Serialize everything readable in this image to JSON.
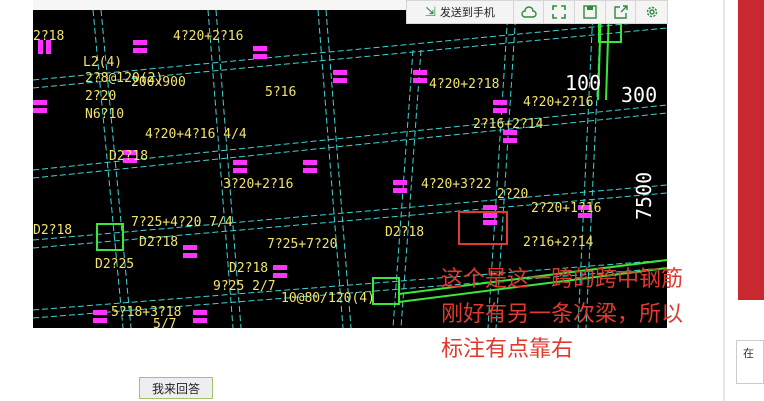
{
  "toolbar": {
    "send_to_phone_label": "发送到手机",
    "icons": [
      "cloud-icon",
      "fullscreen-icon",
      "save-icon",
      "share-icon",
      "settings-icon"
    ]
  },
  "drawing": {
    "labels": {
      "l1": "L2(4)",
      "l2": "200x900",
      "l3": "2?8@120(2)",
      "l4": "2?20",
      "l5": "N6?10",
      "l6": "4?20+2?16",
      "l7": "5?16",
      "l8": "4?20+4?16  4/4",
      "l9": "3?20+2?16",
      "l10": "4?20+2?18",
      "l11": "2?16+2?14",
      "l12": "4?20+2?16",
      "l13": "4?20+3?22",
      "l14": "2?20",
      "l15": "2?20+1?16",
      "l16": "2?16+2?14",
      "l17": "7?25+4?20  7/4",
      "l18": "7?25+7?20",
      "l19": "D2?18",
      "l20": "D2?18",
      "l21": "9?25  2/7",
      "l22": "10@80/120(4)",
      "l23": "5?18+3?18",
      "l24": "D2?25",
      "l25": "D2?18",
      "l26": "D2?18",
      "l27": "100",
      "l28": "300",
      "l29": "7500",
      "l30": "2?18",
      "l31": "D2?18",
      "l32": "5/7"
    }
  },
  "annotation": {
    "line1": "这个是这一跨的跨中钢筋",
    "line2": "刚好有另一条次梁，所以",
    "line3": "标注有点靠右"
  },
  "side_box_label": "在",
  "answer_button_label": "我来回答",
  "colors": {
    "annotation_red": "#e03a2e",
    "cad_background": "#000000",
    "rebar_magenta": "#ff33ff",
    "text_yellow": "#f2e36a",
    "beam_cyan": "#3cd6d6",
    "column_green": "#39e639"
  }
}
